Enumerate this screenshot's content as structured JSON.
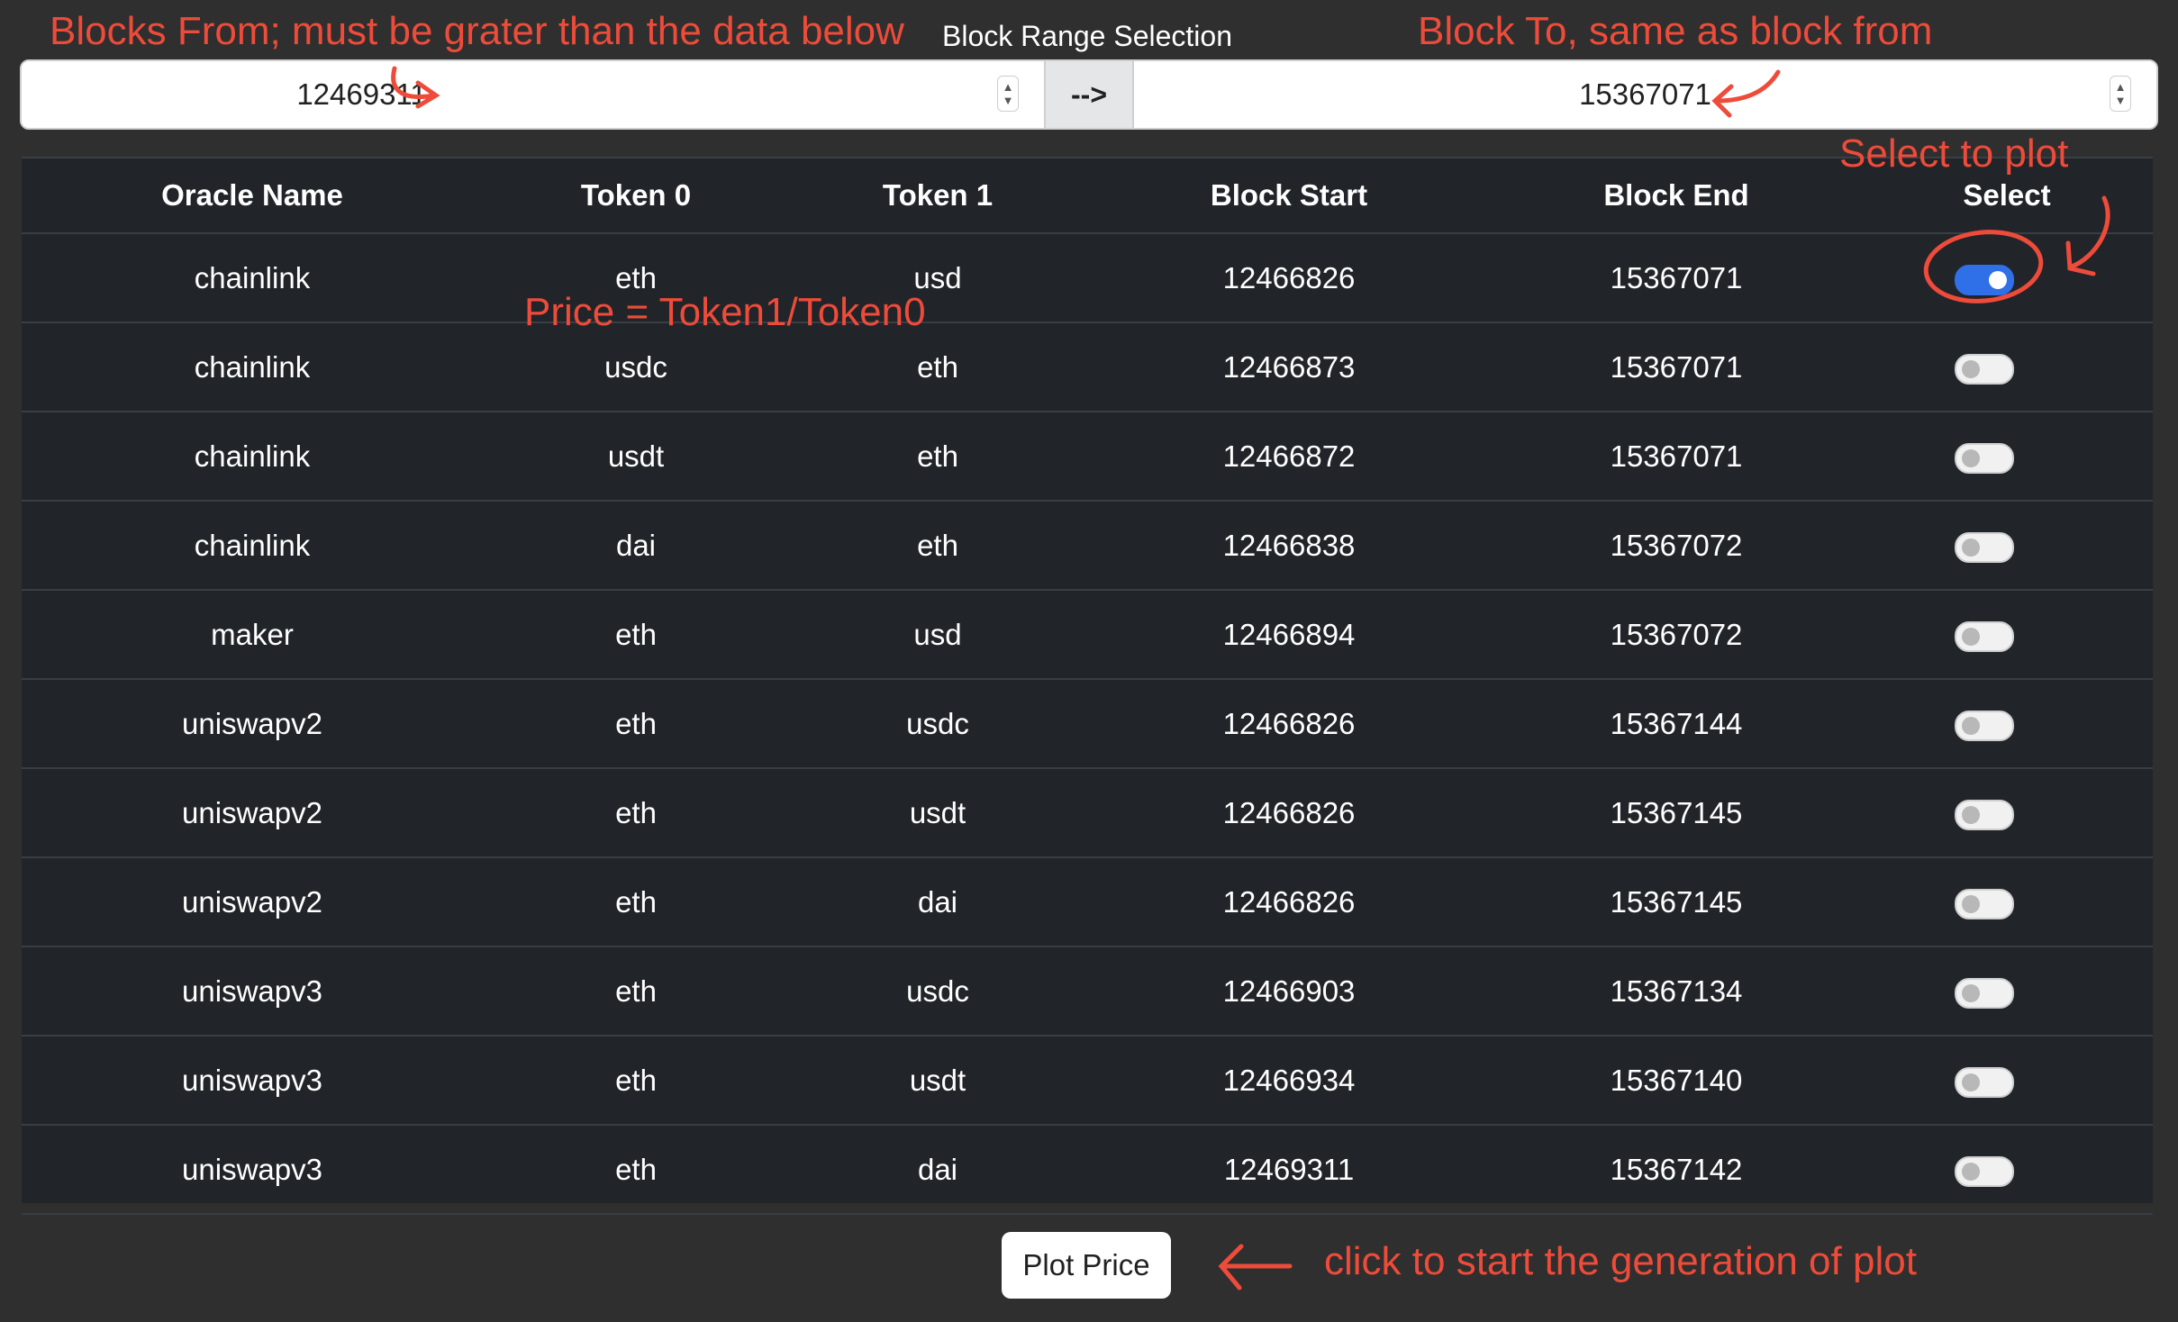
{
  "range": {
    "title": "Block Range Selection",
    "from_value": "12469311",
    "to_value": "15367071",
    "arrow_label": "-->"
  },
  "table": {
    "headers": [
      "Oracle Name",
      "Token 0",
      "Token 1",
      "Block Start",
      "Block End",
      "Select"
    ],
    "rows": [
      {
        "oracle": "chainlink",
        "token0": "eth",
        "token1": "usd",
        "start": "12466826",
        "end": "15367071",
        "selected": true
      },
      {
        "oracle": "chainlink",
        "token0": "usdc",
        "token1": "eth",
        "start": "12466873",
        "end": "15367071",
        "selected": false
      },
      {
        "oracle": "chainlink",
        "token0": "usdt",
        "token1": "eth",
        "start": "12466872",
        "end": "15367071",
        "selected": false
      },
      {
        "oracle": "chainlink",
        "token0": "dai",
        "token1": "eth",
        "start": "12466838",
        "end": "15367072",
        "selected": false
      },
      {
        "oracle": "maker",
        "token0": "eth",
        "token1": "usd",
        "start": "12466894",
        "end": "15367072",
        "selected": false
      },
      {
        "oracle": "uniswapv2",
        "token0": "eth",
        "token1": "usdc",
        "start": "12466826",
        "end": "15367144",
        "selected": false
      },
      {
        "oracle": "uniswapv2",
        "token0": "eth",
        "token1": "usdt",
        "start": "12466826",
        "end": "15367145",
        "selected": false
      },
      {
        "oracle": "uniswapv2",
        "token0": "eth",
        "token1": "dai",
        "start": "12466826",
        "end": "15367145",
        "selected": false
      },
      {
        "oracle": "uniswapv3",
        "token0": "eth",
        "token1": "usdc",
        "start": "12466903",
        "end": "15367134",
        "selected": false
      },
      {
        "oracle": "uniswapv3",
        "token0": "eth",
        "token1": "usdt",
        "start": "12466934",
        "end": "15367140",
        "selected": false
      },
      {
        "oracle": "uniswapv3",
        "token0": "eth",
        "token1": "dai",
        "start": "12469311",
        "end": "15367142",
        "selected": false
      }
    ]
  },
  "plot_button": "Plot Price",
  "annotations": {
    "from_note": "Blocks From; must be grater than the data below",
    "to_note": "Block To, same as block from",
    "select_note": "Select to plot",
    "price_note": "Price = Token1/Token0",
    "plot_note": "click to start the generation of plot"
  },
  "colors": {
    "annotation": "#ee4b3a",
    "toggle_on": "#2f6fe8",
    "table_bg": "#212529",
    "page_bg": "#2f2f2f"
  }
}
